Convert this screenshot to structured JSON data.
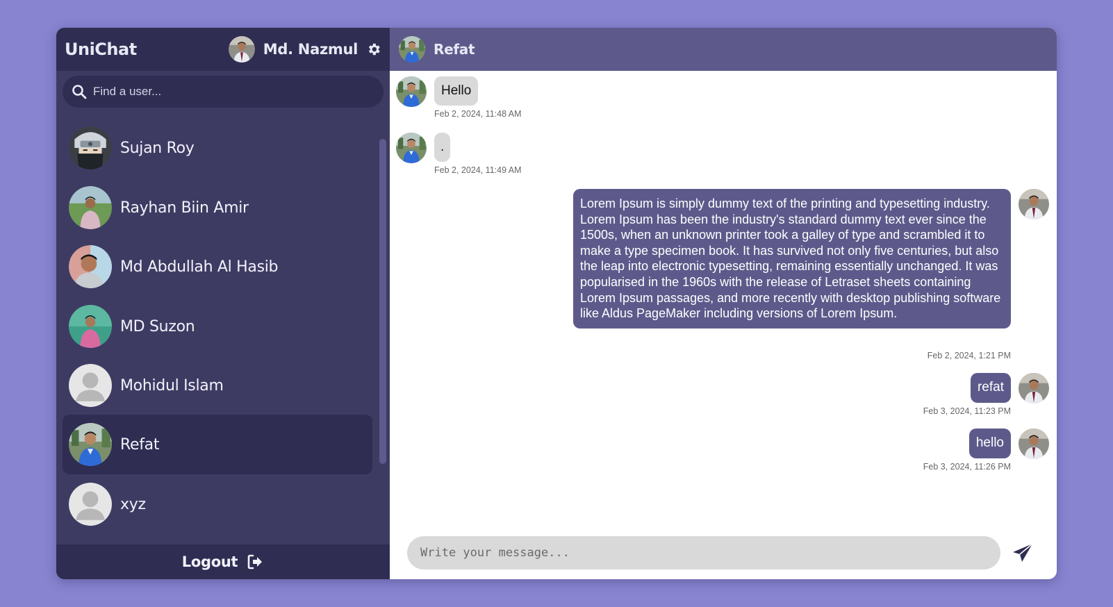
{
  "app": {
    "brand": "UniChat"
  },
  "current_user": {
    "name": "Md. Nazmul",
    "avatar": "nazmul-avatar"
  },
  "search": {
    "placeholder": "Find a user..."
  },
  "users": [
    {
      "name": "Sujan Roy",
      "avatar": "anime-ninja-avatar"
    },
    {
      "name": "Rayhan Biin Amir",
      "avatar": "photo-avatar"
    },
    {
      "name": "Md Abdullah Al Hasib",
      "avatar": "photo-avatar"
    },
    {
      "name": "MD Suzon",
      "avatar": "photo-avatar"
    },
    {
      "name": "Mohidul Islam",
      "avatar": "default-person-avatar"
    },
    {
      "name": "Refat",
      "avatar": "photo-avatar",
      "active": true
    },
    {
      "name": "xyz",
      "avatar": "default-person-avatar"
    }
  ],
  "footer": {
    "logout_label": "Logout"
  },
  "chat": {
    "peer_name": "Refat",
    "messages": [
      {
        "direction": "in",
        "text": "Hello",
        "time": "Feb 2, 2024, 11:48 AM"
      },
      {
        "direction": "in",
        "text": ".",
        "time": "Feb 2, 2024, 11:49 AM"
      },
      {
        "direction": "out",
        "text": "Lorem Ipsum is simply dummy text of the printing and typesetting industry. Lorem Ipsum has been the industry's standard dummy text ever since the 1500s, when an unknown printer took a galley of type and scrambled it to make a type specimen book. It has survived not only five centuries, but also the leap into electronic typesetting, remaining essentially unchanged. It was popularised in the 1960s with the release of Letraset sheets containing Lorem Ipsum passages, and more recently with desktop publishing software like Aldus PageMaker including versions of Lorem Ipsum.",
        "time": "Feb 2, 2024, 1:21 PM"
      },
      {
        "direction": "out",
        "text": "refat",
        "time": "Feb 3, 2024, 11:23 PM"
      },
      {
        "direction": "out",
        "text": "hello",
        "time": "Feb 3, 2024, 11:26 PM"
      }
    ]
  },
  "composer": {
    "placeholder": "Write your message..."
  },
  "colors": {
    "page_bg": "#8884d0",
    "sidebar_bg": "#3e3b63",
    "sidebar_dark": "#2f2d52",
    "accent": "#5d5a8b",
    "incoming_bubble": "#d9d9d9"
  },
  "icons": {
    "search": "search-icon",
    "settings": "gear-icon",
    "logout": "logout-icon",
    "send": "send-icon"
  }
}
